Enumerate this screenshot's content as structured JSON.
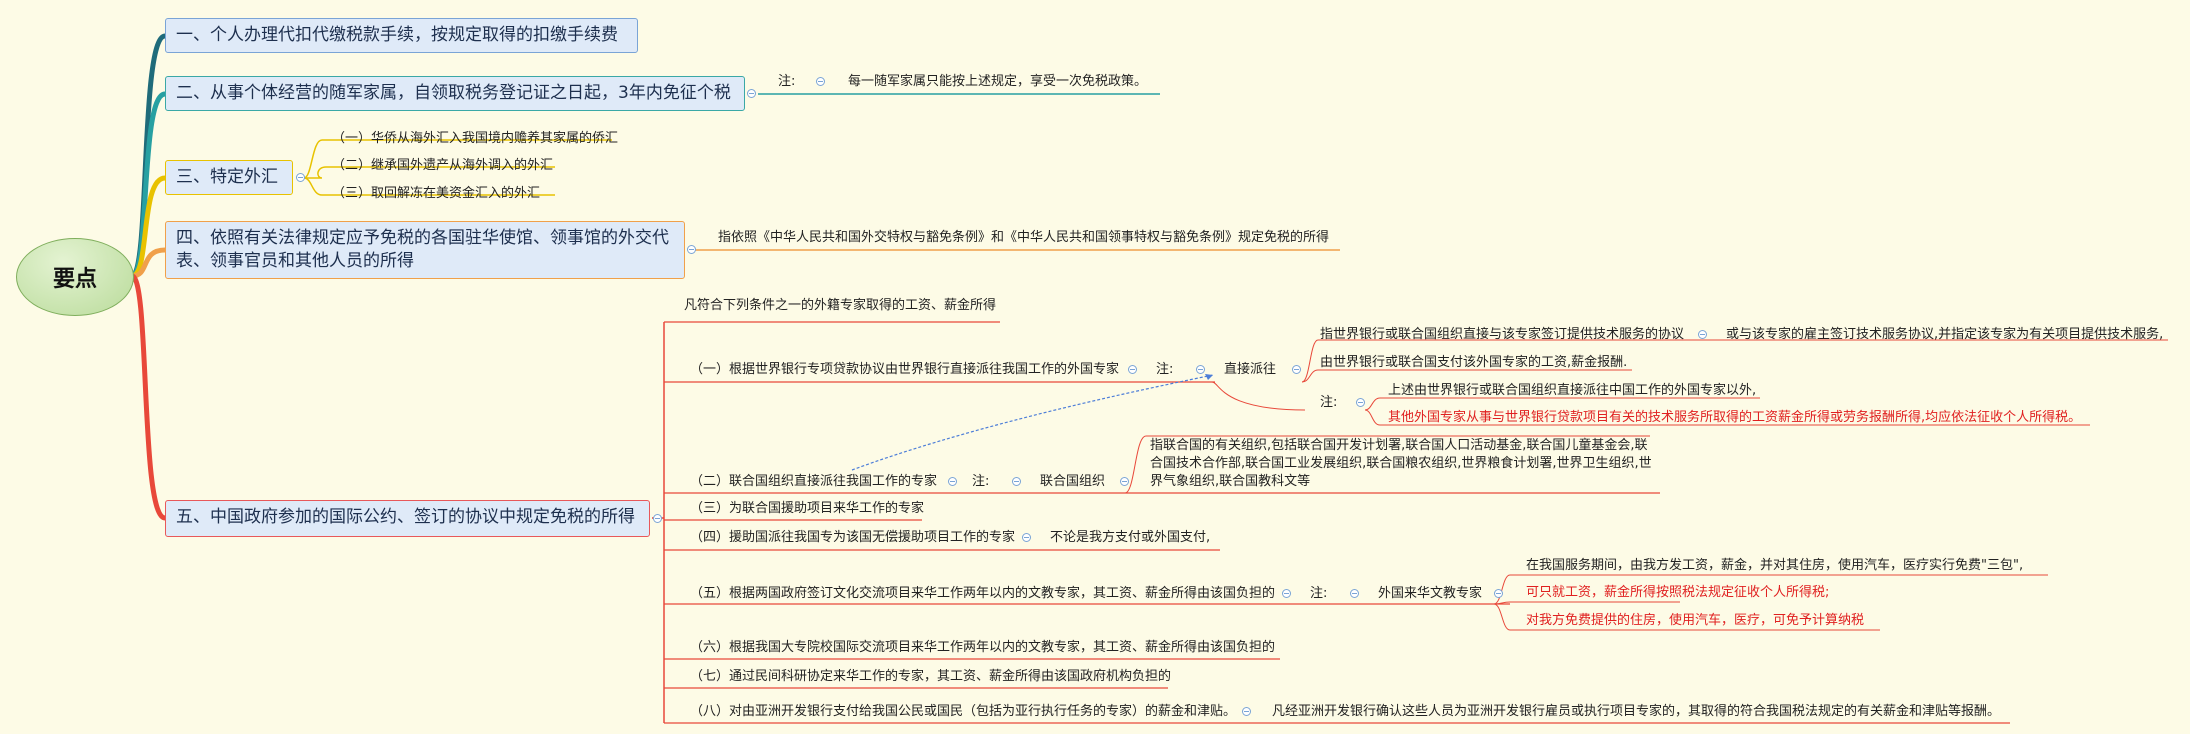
{
  "root": "要点",
  "main": {
    "m1": "一、个人办理代扣代缴税款手续，按规定取得的扣缴手续费",
    "m2": "二、从事个体经营的随军家属，自领取税务登记证之日起，3年内免征个税",
    "m3": "三、特定外汇",
    "m4_line1": "四、依照有关法律规定应予免税的各国驻华使馆、领事馆的外交代",
    "m4_line2": "表、领事官员和其他人员的所得",
    "m5": "五、中国政府参加的国际公约、签订的协议中规定免税的所得"
  },
  "m2_note": {
    "label": "注:",
    "text": "每一随军家属只能按上述规定，享受一次免税政策。"
  },
  "m3_items": [
    "（一）华侨从海外汇入我国境内赡养其家属的侨汇",
    "（二）继承国外遗产从海外调入的外汇",
    "（三）取回解冻在美资金汇入的外汇"
  ],
  "m4_note": "指依照《中华人民共和国外交特权与豁免条例》和《中华人民共和国领事特权与豁免条例》规定免税的所得",
  "m5_children": {
    "intro": "凡符合下列条件之一的外籍专家取得的工资、薪金所得",
    "c1": "（一）根据世界银行专项贷款协议由世界银行直接派往我国工作的外国专家",
    "c1_note_label": "注:",
    "c1_direct": "直接派往",
    "c1_direct_a": "指世界银行或联合国组织直接与该专家签订提供技术服务的协议",
    "c1_direct_a2": "或与该专家的雇主签订技术服务协议,并指定该专家为有关项目提供技术服务,",
    "c1_direct_b": "由世界银行或联合国支付该外国专家的工资,薪金报酬.",
    "c1_note2_label": "注:",
    "c1_note2_a": "上述由世界银行或联合国组织直接派往中国工作的外国专家以外,",
    "c1_note2_b": "其他外国专家从事与世界银行贷款项目有关的技术服务所取得的工资薪金所得或劳务报酬所得,均应依法征收个人所得税。",
    "c2": "（二）联合国组织直接派往我国工作的专家",
    "c2_note_label": "注:",
    "c2_org": "联合国组织",
    "c2_org_text_1": "指联合国的有关组织,包括联合国开发计划署,联合国人口活动基金,联合国儿童基金会,联",
    "c2_org_text_2": "合国技术合作部,联合国工业发展组织,联合国粮农组织,世界粮食计划署,世界卫生组织,世",
    "c2_org_text_3": "界气象组织,联合国教科文等",
    "c3": "（三）为联合国援助项目来华工作的专家",
    "c4": "（四）援助国派往我国专为该国无偿援助项目工作的专家",
    "c4_note": "不论是我方支付或外国支付,",
    "c5": "（五）根据两国政府签订文化交流项目来华工作两年以内的文教专家，其工资、薪金所得由该国负担的",
    "c5_note_label": "注:",
    "c5_expert": "外国来华文教专家",
    "c5_e1": "在我国服务期间，由我方发工资，薪金，并对其住房，使用汽车，医疗实行免费\"三包\",",
    "c5_e2": "可只就工资，薪金所得按照税法规定征收个人所得税;",
    "c5_e3": "对我方免费提供的住房，使用汽车，医疗，可免予计算纳税",
    "c6": "（六）根据我国大专院校国际交流项目来华工作两年以内的文教专家，其工资、薪金所得由该国负担的",
    "c7": "（七）通过民间科研协定来华工作的专家，其工资、薪金所得由该国政府机构负担的",
    "c8": "（八）对由亚洲开发银行支付给我国公民或国民（包括为亚行执行任务的专家）的薪金和津贴。",
    "c8_note": "凡经亚洲开发银行确认这些人员为亚洲开发银行雇员或执行项目专家的，其取得的符合我国税法规定的有关薪金和津贴等报酬。"
  }
}
